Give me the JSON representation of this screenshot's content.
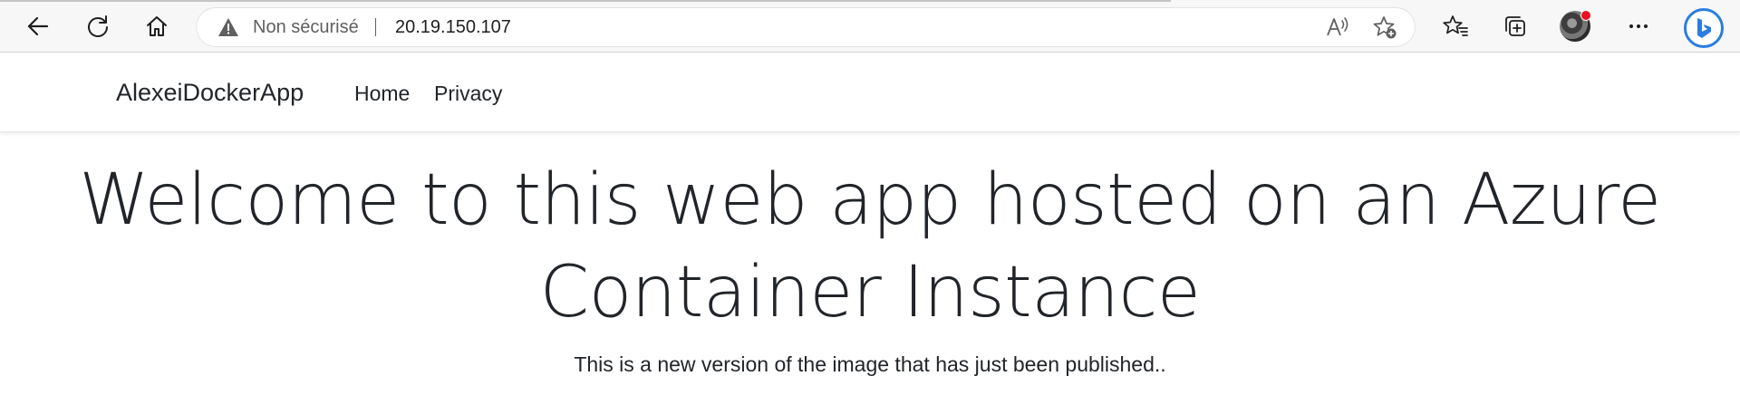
{
  "browser": {
    "address": {
      "security_label": "Non sécurisé",
      "url": "20.19.150.107"
    },
    "icons": {
      "back": "back-arrow-icon",
      "refresh": "refresh-icon",
      "home": "home-icon",
      "warning": "warning-triangle-icon",
      "read_aloud": "read-aloud-icon",
      "add_favorite": "add-favorite-icon",
      "favorites": "favorites-icon",
      "collections": "collections-icon",
      "profile": "avatar",
      "more": "more-icon",
      "bing": "bing-icon"
    },
    "profile_badge_color": "#e81123",
    "bing_color": "#2a7de1"
  },
  "site": {
    "brand": "AlexeiDockerApp",
    "nav": [
      {
        "label": "Home"
      },
      {
        "label": "Privacy"
      }
    ]
  },
  "main": {
    "heading_line1": "Welcome to this web app hosted on an Azure",
    "heading_line2": "Container Instance",
    "subtitle": "This is a new version of the image that has just been published.."
  }
}
